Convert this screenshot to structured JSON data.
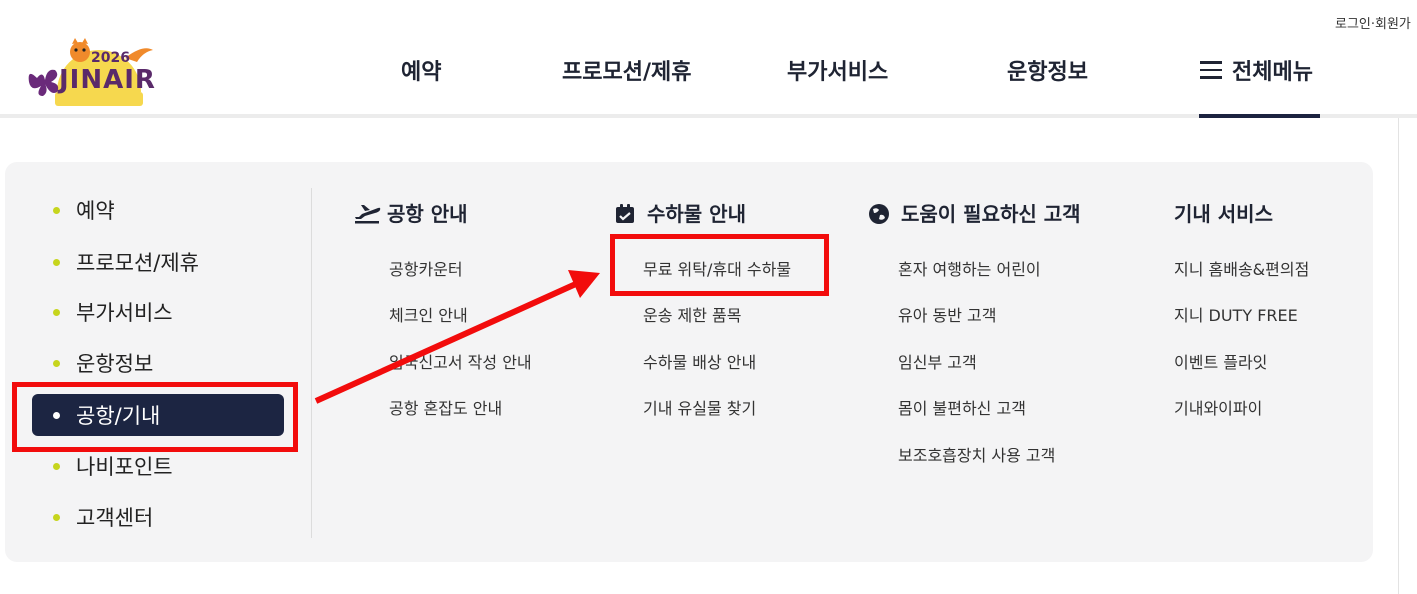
{
  "header": {
    "login_join": "로그인·회원가",
    "logo": {
      "year": "2026",
      "brand": "JINAIR"
    },
    "gnb": [
      "예약",
      "프로모션/제휴",
      "부가서비스",
      "운항정보"
    ],
    "all_menu": "전체메뉴"
  },
  "left_menu": [
    {
      "label": "예약",
      "active": false
    },
    {
      "label": "프로모션/제휴",
      "active": false
    },
    {
      "label": "부가서비스",
      "active": false
    },
    {
      "label": "운항정보",
      "active": false
    },
    {
      "label": "공항/기내",
      "active": true
    },
    {
      "label": "나비포인트",
      "active": false
    },
    {
      "label": "고객센터",
      "active": false
    }
  ],
  "columns": [
    {
      "title": "공항 안내",
      "icon": "airplane-takeoff-icon",
      "items": [
        "공항카운터",
        "체크인 안내",
        "입국신고서 작성 안내",
        "공항 혼잡도 안내"
      ]
    },
    {
      "title": "수하물 안내",
      "icon": "luggage-icon",
      "items": [
        "무료 위탁/휴대 수하물",
        "운송 제한 품목",
        "수하물 배상 안내",
        "기내 유실물 찾기"
      ]
    },
    {
      "title": "도움이 필요하신 고객",
      "icon": "globe-icon",
      "items": [
        "혼자 여행하는 어린이",
        "유아 동반 고객",
        "임신부 고객",
        "몸이 불편하신 고객",
        "보조호흡장치 사용 고객"
      ]
    },
    {
      "title": "기내 서비스",
      "icon": "",
      "items": [
        "지니 홈배송&편의점",
        "지니 DUTY FREE",
        "이벤트 플라잇",
        "기내와이파이"
      ]
    }
  ],
  "colors": {
    "navy": "#1c2542",
    "accent_dot": "#c6d51d",
    "annotation": "#f20c0c",
    "panel_bg": "#f4f4f5"
  }
}
